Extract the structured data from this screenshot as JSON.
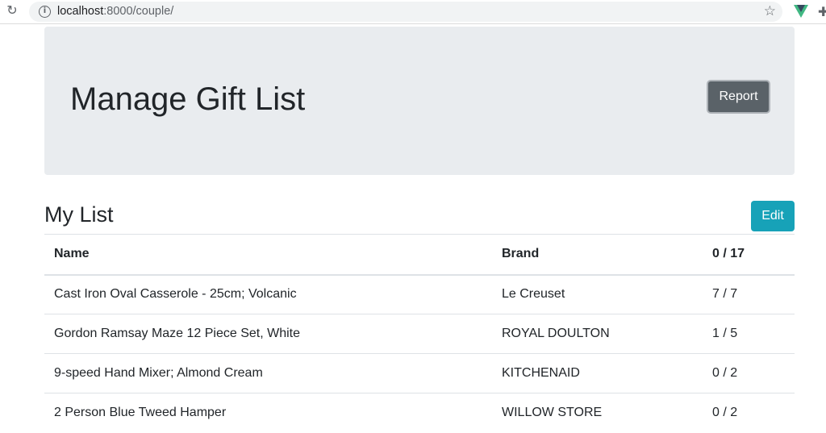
{
  "browser": {
    "url_host": "localhost",
    "url_path": ":8000/couple/"
  },
  "header": {
    "title": "Manage Gift List",
    "report_label": "Report"
  },
  "list": {
    "title": "My List",
    "edit_label": "Edit",
    "columns": [
      "Name",
      "Brand",
      "0 / 17"
    ],
    "rows": [
      {
        "name": "Cast Iron Oval Casserole - 25cm; Volcanic",
        "brand": "Le Creuset",
        "qty": "7 / 7"
      },
      {
        "name": "Gordon Ramsay Maze 12 Piece Set, White",
        "brand": "ROYAL DOULTON",
        "qty": "1 / 5"
      },
      {
        "name": "9-speed Hand Mixer; Almond Cream",
        "brand": "KITCHENAID",
        "qty": "0 / 2"
      },
      {
        "name": "2 Person Blue Tweed Hamper",
        "brand": "WILLOW STORE",
        "qty": "0 / 2"
      }
    ]
  },
  "colors": {
    "jumbotron_bg": "#e9ecef",
    "report_button": "#5a6268",
    "edit_button": "#17a2b8",
    "vue_green": "#41b883",
    "vue_dark": "#35495e"
  },
  "icons": [
    "reload-icon",
    "info-icon",
    "star-icon",
    "vue-devtools-icon",
    "extension-icon"
  ]
}
